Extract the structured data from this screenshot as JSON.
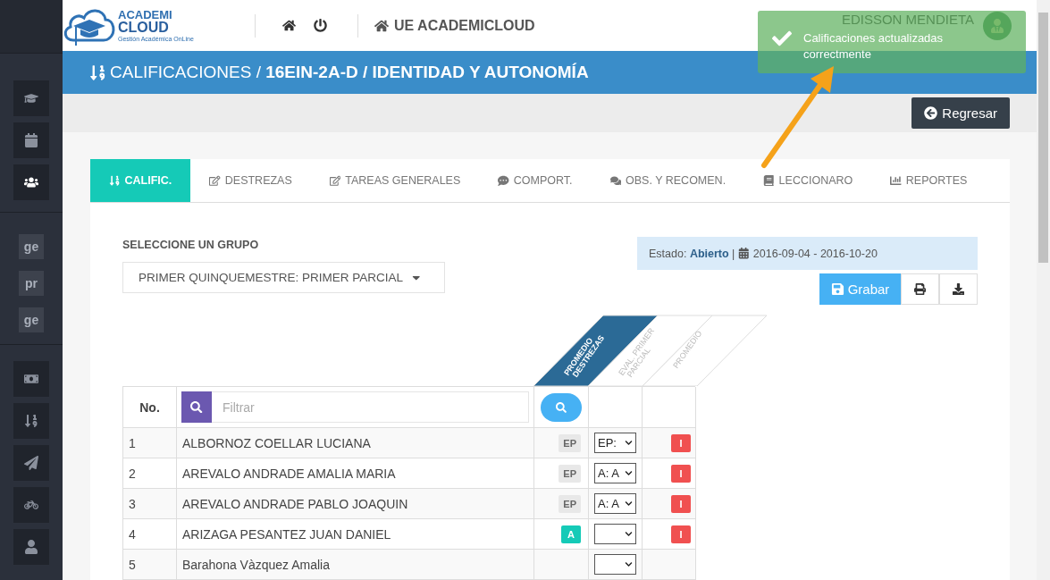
{
  "sidebar": {
    "items": [
      {
        "kind": "icon",
        "selected": false
      },
      {
        "kind": "icon",
        "selected": false
      },
      {
        "kind": "icon",
        "selected": true
      },
      {
        "kind": "divider"
      },
      {
        "kind": "text",
        "label": "ge",
        "selected": false
      },
      {
        "kind": "text",
        "label": "pr",
        "selected": false
      },
      {
        "kind": "text",
        "label": "ge",
        "selected": false
      },
      {
        "kind": "divider"
      },
      {
        "kind": "icon",
        "selected": false
      },
      {
        "kind": "icon",
        "selected": false
      },
      {
        "kind": "icon",
        "selected": false
      },
      {
        "kind": "icon",
        "selected": false
      },
      {
        "kind": "icon",
        "selected": false
      }
    ]
  },
  "header": {
    "logo": {
      "line1": "ACADEMI",
      "line2": "CLOUD",
      "tagline": "Gestión Académica OnLine"
    },
    "institution": "UE ACADEMICLOUD",
    "user_name": "EDISSON MENDIETA"
  },
  "toast": {
    "message": "Calificaciones actualizadas correctmente"
  },
  "breadcrumb": "CALIFICACIONES / **16EIN-2A-D / IDENTIDAD Y AUTONOMÍA**",
  "back_button": "Regresar",
  "tabs": [
    {
      "label": "CALIFIC.",
      "selected": true
    },
    {
      "label": "DESTREZAS",
      "selected": false
    },
    {
      "label": "TAREAS GENERALES",
      "selected": false
    },
    {
      "label": "COMPORT.",
      "selected": false
    },
    {
      "label": "OBS. Y RECOMEN.",
      "selected": false
    },
    {
      "label": "LECCIONARO",
      "selected": false
    },
    {
      "label": "REPORTES",
      "selected": false
    }
  ],
  "group": {
    "label": "SELECCIONE UN GRUPO",
    "value": "PRIMER QUINQUEMESTRE: PRIMER PARCIAL"
  },
  "status": {
    "label": "Estado: **Abierto** |",
    "dates": "2016-09-04 - 2016-10-20"
  },
  "save_button": "Grabar",
  "table": {
    "columns": [
      "PROMEDIO DESTREZAS",
      "EVAL. PRIMER PARCIAL",
      "PROMEDIO"
    ],
    "no_header": "No.",
    "filter": {
      "placeholder": "Filtrar"
    },
    "rows": [
      {
        "no": "1",
        "name": "ALBORNOZ COELLAR LUCIANA",
        "average": {
          "text": "EP",
          "kind": "ep"
        },
        "eval": "EP:",
        "grade": "I"
      },
      {
        "no": "2",
        "name": "AREVALO ANDRADE AMALIA MARIA",
        "average": {
          "text": "EP",
          "kind": "ep"
        },
        "eval": "A: A",
        "grade": "I"
      },
      {
        "no": "3",
        "name": "AREVALO ANDRADE PABLO JOAQUIN",
        "average": {
          "text": "EP",
          "kind": "ep"
        },
        "eval": "A: A",
        "grade": "I"
      },
      {
        "no": "4",
        "name": "ARIZAGA PESANTEZ JUAN DANIEL",
        "average": {
          "text": "A",
          "kind": "a"
        },
        "grade": "I"
      },
      {
        "no": "5",
        "name": "Barahona Vàzquez Amalia"
      }
    ]
  }
}
